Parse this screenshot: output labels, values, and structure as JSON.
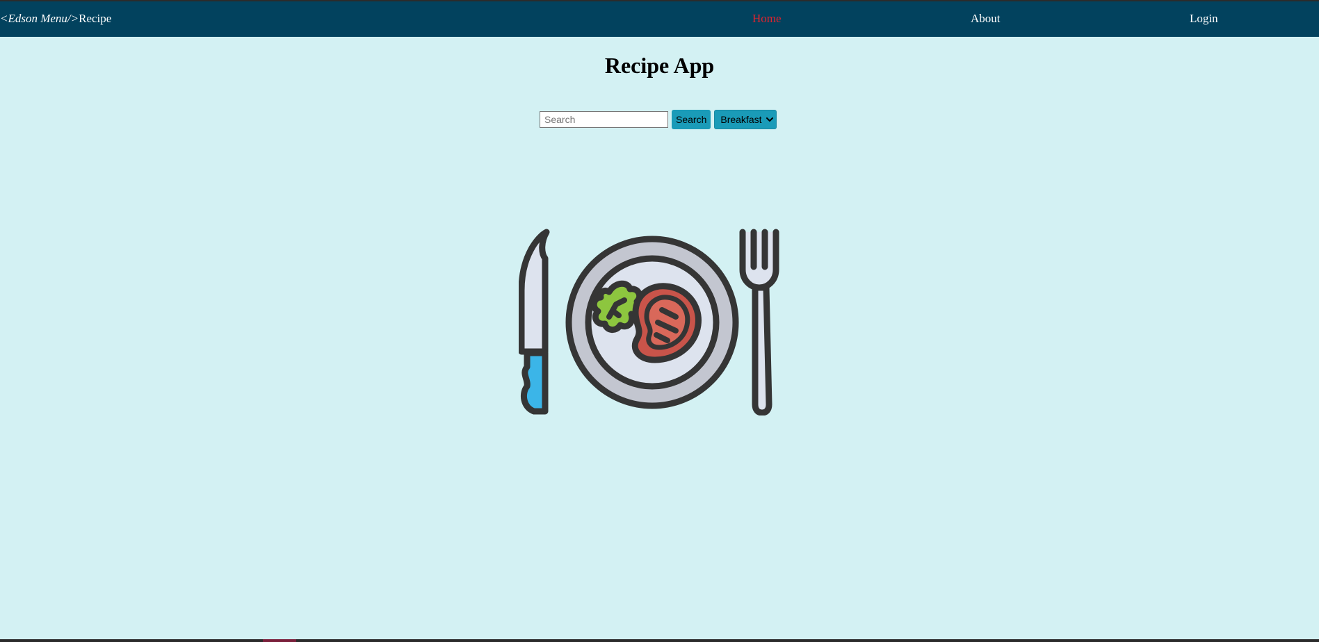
{
  "navbar": {
    "brand_italic": "<Edson Menu/>",
    "brand_text": "Recipe",
    "links": [
      {
        "label": "Home",
        "active": true
      },
      {
        "label": "About",
        "active": false
      },
      {
        "label": "Login",
        "active": false
      }
    ]
  },
  "main": {
    "title": "Recipe App",
    "search": {
      "placeholder": "Search",
      "value": "",
      "button_label": "Search"
    },
    "category_select": {
      "selected": "Breakfast"
    },
    "illustration": "plate-with-knife-and-fork-icon"
  },
  "colors": {
    "navbar_bg": "#02425e",
    "page_bg": "#d3f1f3",
    "active_link": "#e3232d",
    "button_bg": "#1a9bb8"
  }
}
